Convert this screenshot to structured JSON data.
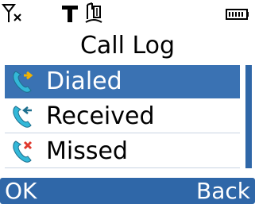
{
  "status_bar": {
    "signal_icon": "no-signal-icon",
    "network_icon": "t-network-icon",
    "profile_icon": "silent-profile-icon",
    "battery_icon": "battery-icon"
  },
  "title": "Call Log",
  "menu": {
    "items": [
      {
        "label": "Dialed",
        "icon": "dialed-call-icon"
      },
      {
        "label": "Received",
        "icon": "received-call-icon"
      },
      {
        "label": "Missed",
        "icon": "missed-call-icon"
      }
    ],
    "selected_index": 0
  },
  "softkeys": {
    "left_label": "OK",
    "right_label": "Back"
  },
  "colors": {
    "selection": "#3a72b3",
    "softkey_bar": "#2f67a8",
    "scrollbar": "#2f67a8"
  }
}
